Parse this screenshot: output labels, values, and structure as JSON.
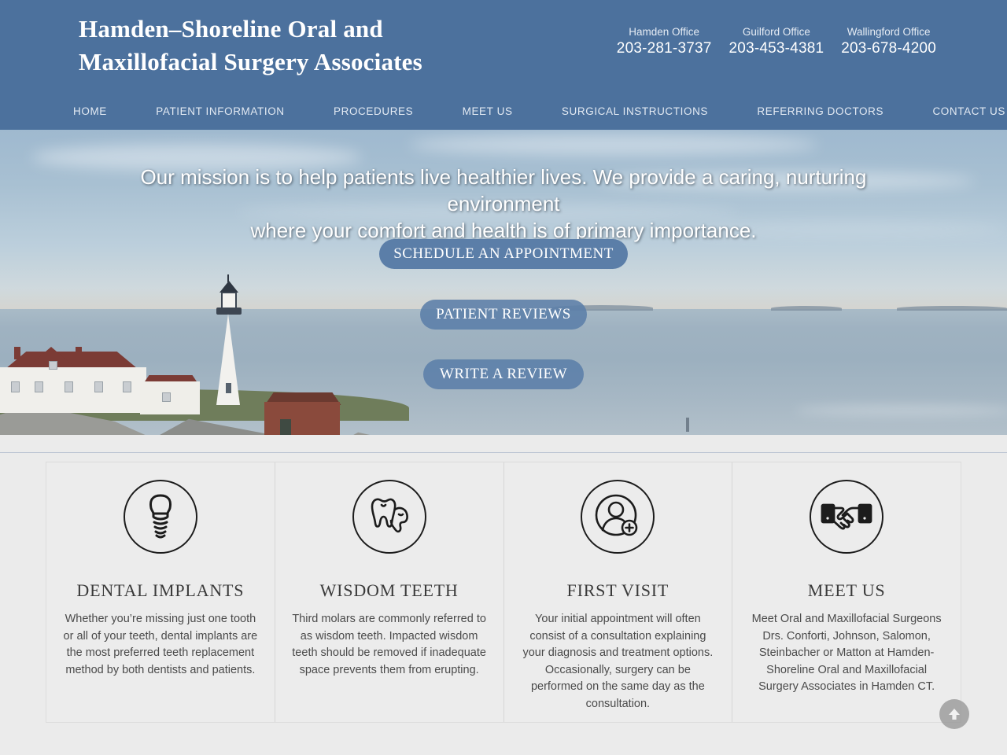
{
  "theme": {
    "header_blue": "#4c719d",
    "button_blue": "#5b7ea8",
    "page_bg": "#ebebeb",
    "card_bg": "#ececec",
    "divider_rule": "#b9c3d2"
  },
  "header": {
    "brand_line1": "Hamden–Shoreline Oral and",
    "brand_line2": "Maxillofacial Surgery Associates",
    "offices": [
      {
        "name": "Hamden Office",
        "phone": "203-281-3737"
      },
      {
        "name": "Guilford Office",
        "phone": "203-453-4381"
      },
      {
        "name": "Wallingford Office",
        "phone": "203-678-4200"
      }
    ]
  },
  "nav": {
    "items": [
      {
        "label": "HOME"
      },
      {
        "label": "PATIENT INFORMATION"
      },
      {
        "label": "PROCEDURES"
      },
      {
        "label": "MEET US"
      },
      {
        "label": "SURGICAL INSTRUCTIONS"
      },
      {
        "label": "REFERRING DOCTORS"
      },
      {
        "label": "CONTACT US"
      }
    ]
  },
  "hero": {
    "tagline_line1": "Our mission is to help patients live healthier lives. We provide a caring, nurturing environment",
    "tagline_line2": "where your comfort and health is of primary importance.",
    "cta": [
      {
        "label": "SCHEDULE AN APPOINTMENT"
      },
      {
        "label": "PATIENT REVIEWS"
      },
      {
        "label": "WRITE A REVIEW"
      }
    ]
  },
  "cards": [
    {
      "icon": "dental-implant-icon",
      "title": "DENTAL IMPLANTS",
      "desc": "Whether you’re missing just one tooth or all of your teeth, dental implants are the most preferred teeth replacement method by both dentists and patients."
    },
    {
      "icon": "wisdom-teeth-icon",
      "title": "WISDOM TEETH",
      "desc": "Third molars are commonly referred to as wisdom teeth. Impacted wisdom teeth should be removed if inadequate space prevents them from erupting."
    },
    {
      "icon": "patient-add-icon",
      "title": "FIRST VISIT",
      "desc": "Your initial appointment will often consist of a consultation explaining your diagnosis and treatment options. Occasionally, surgery can be performed on the same day as the consultation."
    },
    {
      "icon": "handshake-icon",
      "title": "MEET US",
      "desc": "Meet Oral and Maxillofacial Surgeons Drs. Conforti, Johnson, Salomon, Steinbacher or Matton at Hamden-Shoreline Oral and Maxillofacial Surgery Associates in Hamden CT."
    }
  ],
  "scroll_top": {
    "icon": "arrow-up-icon"
  }
}
